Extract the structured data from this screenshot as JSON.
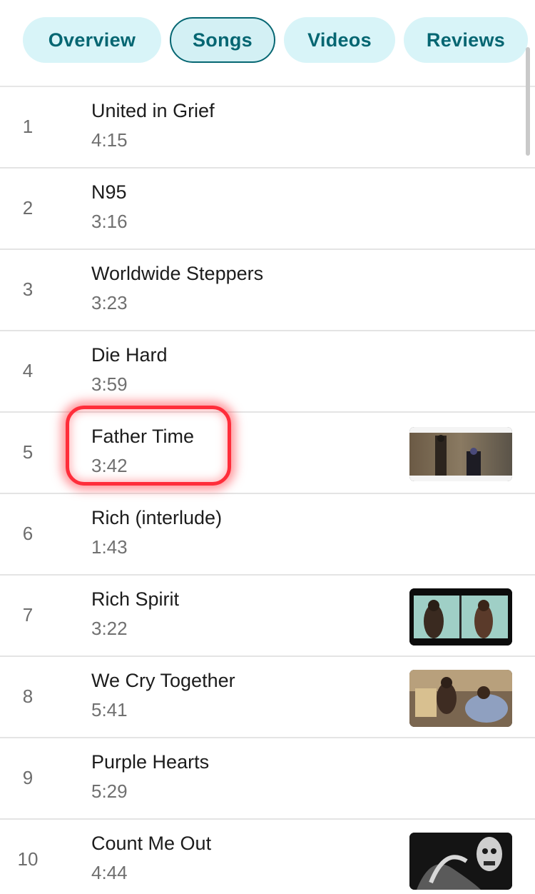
{
  "tabs": {
    "overview": "Overview",
    "songs": "Songs",
    "videos": "Videos",
    "reviews": "Reviews",
    "selected": "Songs"
  },
  "songs": [
    {
      "number": "1",
      "title": "United in Grief",
      "duration": "4:15",
      "has_video": false
    },
    {
      "number": "2",
      "title": "N95",
      "duration": "3:16",
      "has_video": false
    },
    {
      "number": "3",
      "title": "Worldwide Steppers",
      "duration": "3:23",
      "has_video": false
    },
    {
      "number": "4",
      "title": "Die Hard",
      "duration": "3:59",
      "has_video": false
    },
    {
      "number": "5",
      "title": "Father Time",
      "duration": "3:42",
      "has_video": true,
      "highlighted": true
    },
    {
      "number": "6",
      "title": "Rich (interlude)",
      "duration": "1:43",
      "has_video": false
    },
    {
      "number": "7",
      "title": "Rich Spirit",
      "duration": "3:22",
      "has_video": true
    },
    {
      "number": "8",
      "title": "We Cry Together",
      "duration": "5:41",
      "has_video": true
    },
    {
      "number": "9",
      "title": "Purple Hearts",
      "duration": "5:29",
      "has_video": false
    },
    {
      "number": "10",
      "title": "Count Me Out",
      "duration": "4:44",
      "has_video": true
    }
  ],
  "colors": {
    "accent": "#056672",
    "chip_bg": "#d8f4f8",
    "highlight": "#ff2d3a"
  }
}
